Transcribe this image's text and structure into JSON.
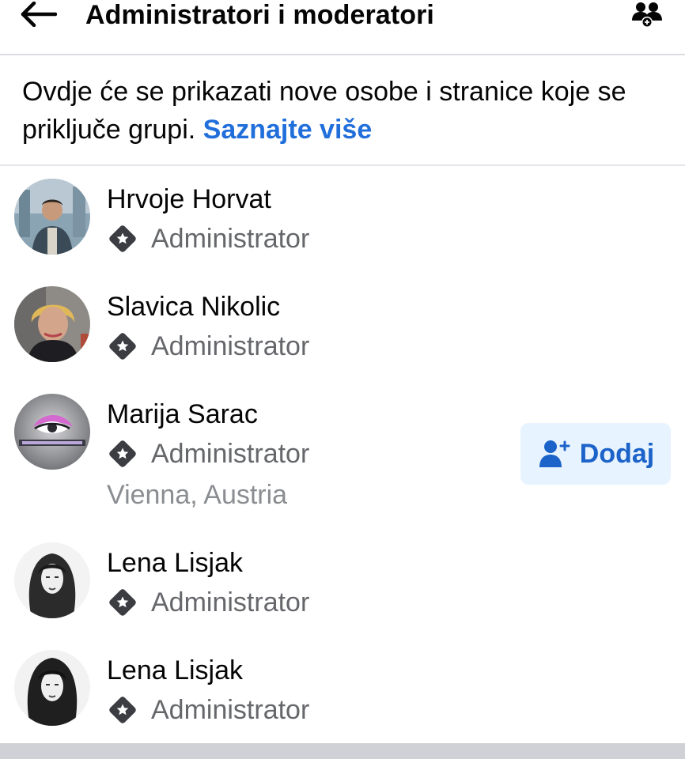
{
  "header": {
    "title": "Administratori i moderatori",
    "back_icon": "arrow-left-icon",
    "people_icon": "people-add-icon"
  },
  "info": {
    "text": "Ovdje će se prikazati nove osobe i stranice koje se priključe grupi.",
    "link": "Saznajte više"
  },
  "members": [
    {
      "name": "Hrvoje Horvat",
      "role": "Administrator"
    },
    {
      "name": "Slavica Nikolic",
      "role": "Administrator"
    },
    {
      "name": "Marija Sarac",
      "role": "Administrator",
      "location": "Vienna, Austria",
      "action": "Dodaj"
    },
    {
      "name": "Lena Lisjak",
      "role": "Administrator"
    },
    {
      "name": "Lena Lisjak",
      "role": "Administrator"
    }
  ],
  "colors": {
    "accent": "#216fdb",
    "button_bg": "#e7f3ff",
    "secondary_text": "#65676b",
    "muted_text": "#8a8d91",
    "icon_dark": "#3b3d42"
  }
}
